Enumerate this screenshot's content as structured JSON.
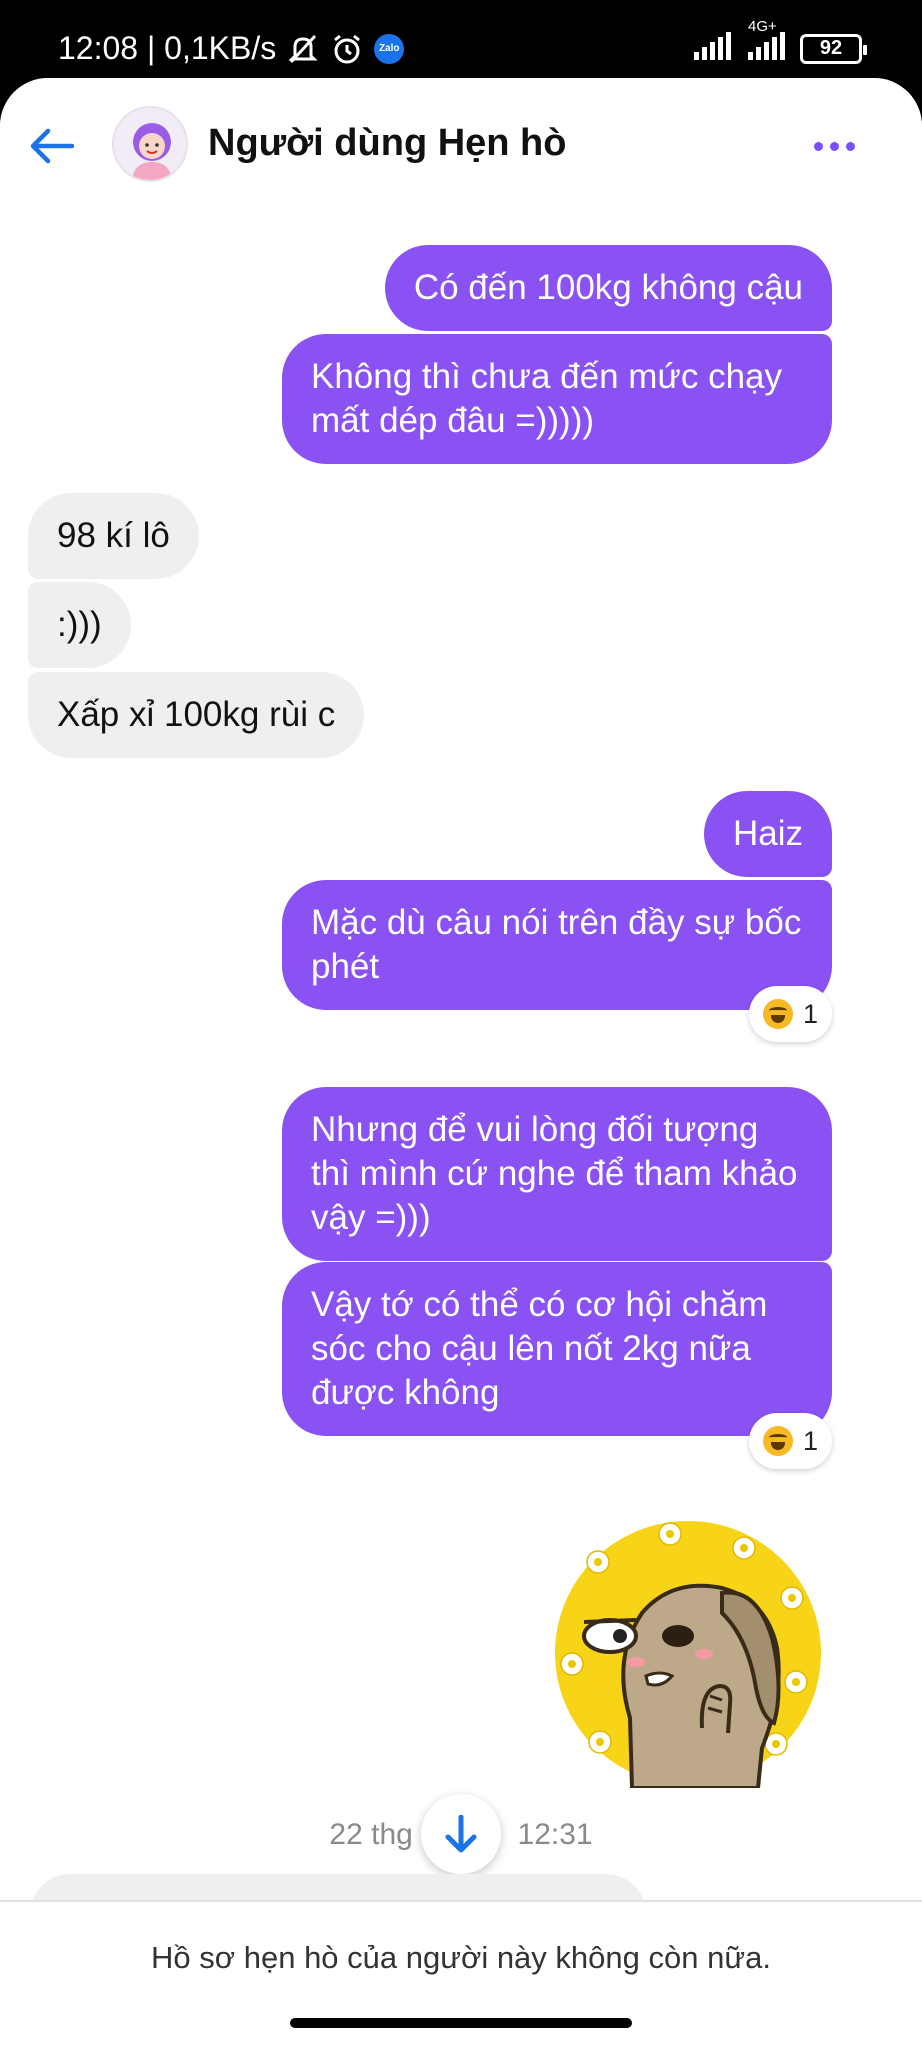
{
  "status_bar": {
    "time_speed": "12:08 | 0,1KB/s",
    "zalo_label": "Zalo",
    "network": "4G+",
    "battery": "92"
  },
  "header": {
    "title": "Người dùng Hẹn hò",
    "back_icon": "back-arrow-icon",
    "more_icon": "more-dots-icon"
  },
  "colors": {
    "outgoing_bubble": "#8a52f2",
    "incoming_bubble": "#efeff1",
    "accent": "#7c4dff",
    "link_blue": "#1a73e8"
  },
  "messages": [
    {
      "direction": "out",
      "text": "Có đến 100kg không cậu"
    },
    {
      "direction": "out",
      "text": "Không thì chưa đến mức chạy mất dép đâu =)))))"
    },
    {
      "direction": "in",
      "text": "98 kí lô"
    },
    {
      "direction": "in",
      "text": ":)))"
    },
    {
      "direction": "in",
      "text": "Xấp xỉ 100kg rùi c"
    },
    {
      "direction": "out",
      "text": "Haiz"
    },
    {
      "direction": "out",
      "text": "Mặc dù câu nói trên đầy sự bốc phét",
      "reaction": {
        "emoji": "laughing-emoji-icon",
        "count": "1"
      }
    },
    {
      "direction": "out",
      "text": "Nhưng để vui lòng đối tượng thì mình cứ nghe để tham khảo vậy =)))"
    },
    {
      "direction": "out",
      "text": "Vậy tớ có thể có cơ hội chăm sóc cho cậu lên nốt 2kg nữa được không",
      "reaction": {
        "emoji": "laughing-emoji-icon",
        "count": "1"
      }
    }
  ],
  "sticker": {
    "icon": "dog-sticker-with-flowers"
  },
  "timestamp": {
    "left": "22 thg",
    "right": "12:31"
  },
  "scroll_down_icon": "arrow-down-icon",
  "notice": "Hồ sơ hẹn hò của người này không còn nữa."
}
